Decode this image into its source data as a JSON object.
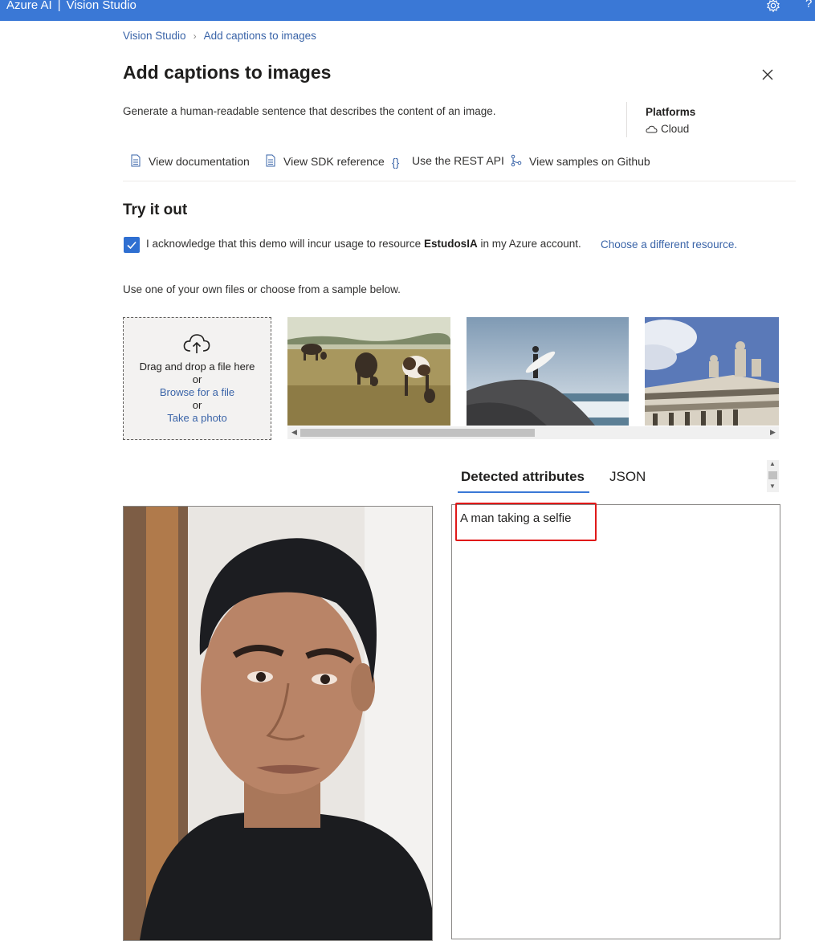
{
  "topbar": {
    "brand": "Azure AI",
    "separator": "|",
    "product": "Vision Studio",
    "help_glyph": "?",
    "icons": [
      "gear-icon",
      "help-icon"
    ],
    "color": "#3a78d6"
  },
  "breadcrumb": {
    "root": "Vision Studio",
    "current": "Add captions to images"
  },
  "page": {
    "title": "Add captions to images",
    "description": "Generate a human-readable sentence that describes the content of an image.",
    "platforms_title": "Platforms",
    "platform": "Cloud"
  },
  "links": [
    {
      "label": "View documentation",
      "icon": "document-icon"
    },
    {
      "label": "View SDK reference",
      "icon": "document-icon"
    },
    {
      "label": "Use the REST API",
      "icon": "braces-icon"
    },
    {
      "label": "View samples on Github",
      "icon": "branch-icon"
    }
  ],
  "try_it": {
    "title": "Try it out",
    "ack_checked": true,
    "ack_prefix": "I acknowledge that this demo will incur usage to resource ",
    "ack_resource": "EstudosIA",
    "ack_suffix": " in my Azure account.",
    "ack_link": "Choose a different resource.",
    "use_files": "Use one of your own files or choose from a sample below."
  },
  "dropzone": {
    "drag_text": "Drag and drop a file here",
    "or1": "or",
    "browse": "Browse for a file",
    "or2": "or",
    "photo": "Take a photo"
  },
  "samples": [
    "cows grazing in a field",
    "surfer on a rock",
    "building with statues"
  ],
  "results": {
    "tab_active": "Detected attributes",
    "tab_json": "JSON",
    "caption": "A man taking a selfie",
    "highlight_color": "#e01919"
  }
}
